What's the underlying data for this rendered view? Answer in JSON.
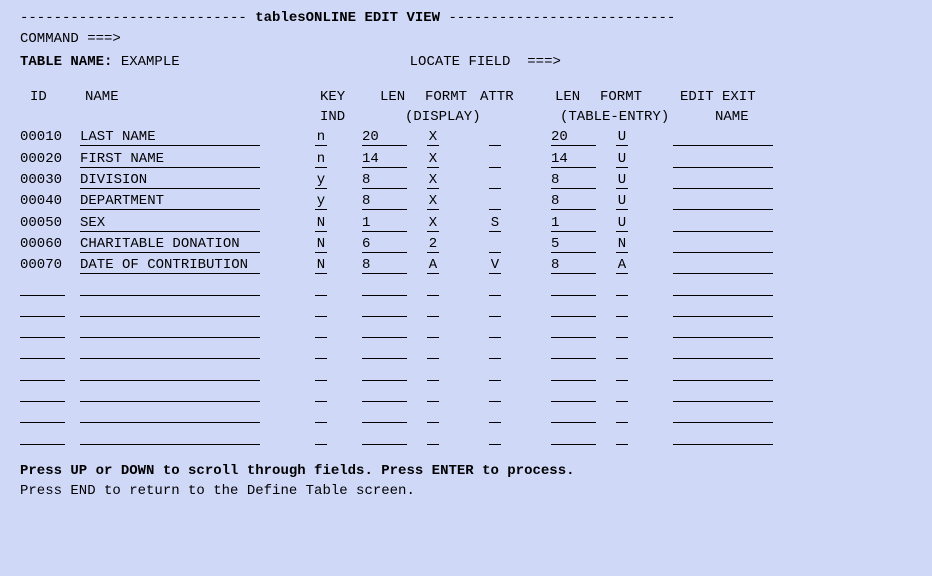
{
  "title_dash_left": "--------------------------- ",
  "title_text": "tablesONLINE EDIT VIEW",
  "title_dash_right": " ---------------------------",
  "command_label": "COMMAND ===>",
  "command_value": "",
  "table_name_label": "TABLE NAME:",
  "table_name_value": "EXAMPLE",
  "locate_field_label": "LOCATE FIELD  ===>",
  "locate_field_value": "",
  "headers": {
    "id": "ID",
    "name": "NAME",
    "key": "KEY",
    "ind": "IND",
    "len": "LEN",
    "formt": "FORMT",
    "attr": "ATTR",
    "display": "(DISPLAY)",
    "len2": "LEN",
    "formt2": "FORMT",
    "table_entry": "(TABLE-ENTRY)",
    "edit_exit": "EDIT EXIT",
    "edit_name": "NAME"
  },
  "rows": [
    {
      "id": "00010",
      "name": "LAST NAME",
      "key": "n",
      "len": "20",
      "fmt": "X",
      "attr": "",
      "len2": "20",
      "fmt2": "U",
      "exit": ""
    },
    {
      "id": "00020",
      "name": "FIRST NAME",
      "key": "n",
      "len": "14",
      "fmt": "X",
      "attr": "",
      "len2": "14",
      "fmt2": "U",
      "exit": ""
    },
    {
      "id": "00030",
      "name": "DIVISION",
      "key": "y",
      "len": "8",
      "fmt": "X",
      "attr": "",
      "len2": "8",
      "fmt2": "U",
      "exit": ""
    },
    {
      "id": "00040",
      "name": "DEPARTMENT",
      "key": "y",
      "len": "8",
      "fmt": "X",
      "attr": "",
      "len2": "8",
      "fmt2": "U",
      "exit": ""
    },
    {
      "id": "00050",
      "name": "SEX",
      "key": "N",
      "len": "1",
      "fmt": "X",
      "attr": "S",
      "len2": "1",
      "fmt2": "U",
      "exit": ""
    },
    {
      "id": "00060",
      "name": "CHARITABLE DONATION",
      "key": "N",
      "len": "6",
      "fmt": "2",
      "attr": "",
      "len2": "5",
      "fmt2": "N",
      "exit": ""
    },
    {
      "id": "00070",
      "name": "DATE OF CONTRIBUTION",
      "key": "N",
      "len": "8",
      "fmt": "A",
      "attr": "V",
      "len2": "8",
      "fmt2": "A",
      "exit": ""
    },
    {
      "id": "",
      "name": "",
      "key": "",
      "len": "",
      "fmt": "",
      "attr": "",
      "len2": "",
      "fmt2": "",
      "exit": ""
    },
    {
      "id": "",
      "name": "",
      "key": "",
      "len": "",
      "fmt": "",
      "attr": "",
      "len2": "",
      "fmt2": "",
      "exit": ""
    },
    {
      "id": "",
      "name": "",
      "key": "",
      "len": "",
      "fmt": "",
      "attr": "",
      "len2": "",
      "fmt2": "",
      "exit": ""
    },
    {
      "id": "",
      "name": "",
      "key": "",
      "len": "",
      "fmt": "",
      "attr": "",
      "len2": "",
      "fmt2": "",
      "exit": ""
    },
    {
      "id": "",
      "name": "",
      "key": "",
      "len": "",
      "fmt": "",
      "attr": "",
      "len2": "",
      "fmt2": "",
      "exit": ""
    },
    {
      "id": "",
      "name": "",
      "key": "",
      "len": "",
      "fmt": "",
      "attr": "",
      "len2": "",
      "fmt2": "",
      "exit": ""
    },
    {
      "id": "",
      "name": "",
      "key": "",
      "len": "",
      "fmt": "",
      "attr": "",
      "len2": "",
      "fmt2": "",
      "exit": ""
    },
    {
      "id": "",
      "name": "",
      "key": "",
      "len": "",
      "fmt": "",
      "attr": "",
      "len2": "",
      "fmt2": "",
      "exit": ""
    }
  ],
  "footer_bold": "Press UP or DOWN to scroll through fields. Press ENTER to process.",
  "footer_plain": "Press END to return to the Define Table screen."
}
